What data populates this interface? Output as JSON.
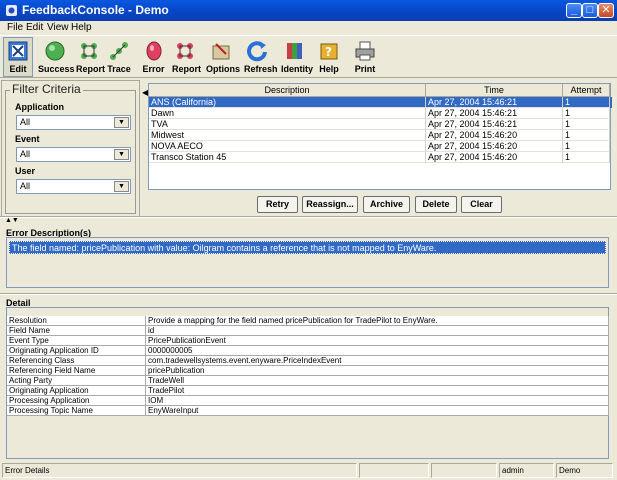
{
  "window": {
    "title": "FeedbackConsole - Demo",
    "min_glyph": "_",
    "max_glyph": "□",
    "close_glyph": "✕"
  },
  "menu": [
    "File",
    "Edit",
    "View",
    "Help"
  ],
  "toolbar": [
    {
      "label": "Edit",
      "icon": "edit-icon"
    },
    {
      "label": "Success",
      "icon": "success-icon"
    },
    {
      "label": "Report",
      "icon": "report-icon"
    },
    {
      "label": "Trace",
      "icon": "trace-icon"
    },
    {
      "label": "Error",
      "icon": "error-icon"
    },
    {
      "label": "Report",
      "icon": "report-icon"
    },
    {
      "label": "Options",
      "icon": "options-icon"
    },
    {
      "label": "Refresh",
      "icon": "refresh-icon"
    },
    {
      "label": "Identity",
      "icon": "identity-icon"
    },
    {
      "label": "Help",
      "icon": "help-icon"
    },
    {
      "label": "Print",
      "icon": "print-icon"
    }
  ],
  "filter": {
    "title": "Filter Criteria",
    "application_label": "Application",
    "application_value": "All",
    "event_label": "Event",
    "event_value": "All",
    "user_label": "User",
    "user_value": "All"
  },
  "events": {
    "columns": [
      "Description",
      "Time",
      "Attempt"
    ],
    "rows": [
      {
        "description": "ANS (California)",
        "time": "Apr 27, 2004 15:46:21",
        "attempt": "1",
        "selected": true
      },
      {
        "description": "Dawn",
        "time": "Apr 27, 2004 15:46:21",
        "attempt": "1"
      },
      {
        "description": "TVA",
        "time": "Apr 27, 2004 15:46:21",
        "attempt": "1"
      },
      {
        "description": "Midwest",
        "time": "Apr 27, 2004 15:46:20",
        "attempt": "1"
      },
      {
        "description": "NOVA AECO",
        "time": "Apr 27, 2004 15:46:20",
        "attempt": "1"
      },
      {
        "description": "Transco Station 45",
        "time": "Apr 27, 2004 15:46:20",
        "attempt": "1"
      }
    ]
  },
  "actions": {
    "retry": "Retry",
    "reassign": "Reassign...",
    "archive": "Archive",
    "delete": "Delete",
    "clear": "Clear"
  },
  "error_section": {
    "title": "Error Description(s)",
    "text": "The field named: pricePublication with value: Oilgram contains a reference that is not mapped to EnyWare."
  },
  "detail": {
    "title": "Detail",
    "rows": [
      [
        "Resolution",
        "Provide a mapping for the field named pricePublication for TradePilot to EnyWare."
      ],
      [
        "Field Name",
        "id"
      ],
      [
        "Event Type",
        "PricePublicationEvent"
      ],
      [
        "Originating Application ID",
        "0000000005"
      ],
      [
        "Referencing Class",
        "com.tradewellsystems.event.enyware.PriceIndexEvent"
      ],
      [
        "Referencing Field Name",
        "pricePublication"
      ],
      [
        "Acting Party",
        "TradeWell"
      ],
      [
        "Originating Application",
        "TradePilot"
      ],
      [
        "Processing Application",
        "IOM"
      ],
      [
        "Processing Topic Name",
        "EnyWareInput"
      ]
    ]
  },
  "status": {
    "message": "Error Details",
    "user": "admin",
    "mode": "Demo"
  }
}
